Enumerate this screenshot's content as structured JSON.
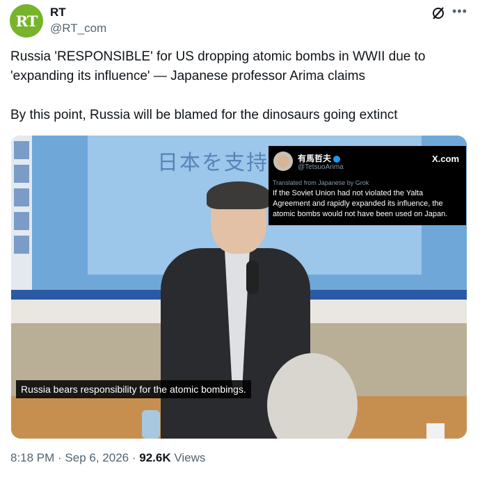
{
  "account": {
    "name": "RT",
    "handle": "@RT_com",
    "avatar_text": "RT",
    "avatar_color": "#77b32b"
  },
  "icons": {
    "grok": "grok-slash-icon",
    "more": "more-dots-icon"
  },
  "tweet": {
    "text_line1": "Russia 'RESPONSIBLE' for US dropping atomic bombs in WWII due to 'expanding its influence' — Japanese professor Arima claims",
    "text_line2": "By this point, Russia will be blamed for the dinosaurs going extinct"
  },
  "media": {
    "slide_text": "日本を支持",
    "caption": "Russia bears responsibility for the atomic bombings.",
    "quote": {
      "name": "有馬哲夫",
      "handle": "@TetsuoArima",
      "site": "X.com",
      "translated_label": "Translated from Japanese by Grok",
      "body": "If the Soviet Union had not violated the Yalta Agreement and rapidly expanded its influence, the atomic bombs would not have been used on Japan."
    }
  },
  "footer": {
    "time": "8:18 PM",
    "date": "Sep 6, 2026",
    "views_count": "92.6K",
    "views_label": "Views"
  },
  "colors": {
    "text": "#0f1419",
    "secondary": "#536471",
    "verified": "#1d9bf0"
  }
}
